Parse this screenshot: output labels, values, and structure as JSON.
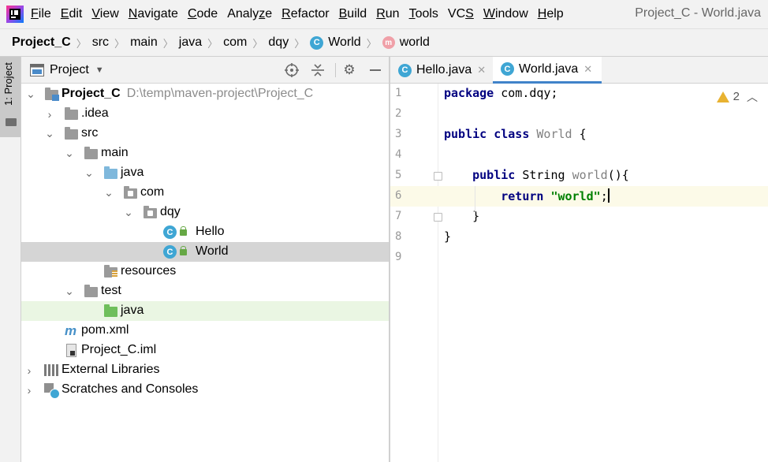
{
  "menu": {
    "items": [
      {
        "mn": "F",
        "rest": "ile"
      },
      {
        "mn": "E",
        "rest": "dit"
      },
      {
        "mn": "V",
        "rest": "iew"
      },
      {
        "mn": "N",
        "rest": "avigate"
      },
      {
        "mn": "C",
        "rest": "ode"
      },
      {
        "pre": "Analy",
        "mn": "z",
        "rest": "e"
      },
      {
        "mn": "R",
        "rest": "efactor"
      },
      {
        "mn": "B",
        "rest": "uild"
      },
      {
        "mn": "R",
        "rest": "un"
      },
      {
        "mn": "T",
        "rest": "ools"
      },
      {
        "pre": "VC",
        "mn": "S",
        "rest": ""
      },
      {
        "mn": "W",
        "rest": "indow"
      },
      {
        "mn": "H",
        "rest": "elp"
      }
    ],
    "window_title": "Project_C - World.java"
  },
  "breadcrumb": {
    "items": [
      "Project_C",
      "src",
      "main",
      "java",
      "com",
      "dqy",
      "World",
      "world"
    ]
  },
  "left_strip": {
    "label": "1: Project"
  },
  "project_panel": {
    "title": "Project",
    "dropdown_icon": "chevron-down-icon",
    "tools": [
      "locate-icon",
      "collapse-all-icon",
      "gear-icon",
      "minimize-icon"
    ],
    "root_name": "Project_C",
    "root_path": "D:\\temp\\maven-project\\Project_C",
    "nodes": {
      "idea": ".idea",
      "src": "src",
      "main": "main",
      "main_java": "java",
      "com": "com",
      "dqy": "dqy",
      "hello": "Hello",
      "world": "World",
      "resources": "resources",
      "test": "test",
      "test_java": "java",
      "pom": "pom.xml",
      "iml": "Project_C.iml",
      "libraries": "External Libraries",
      "scratches": "Scratches and Consoles"
    },
    "selected": "World"
  },
  "editor": {
    "tabs": [
      {
        "label": "Hello.java",
        "active": false
      },
      {
        "label": "World.java",
        "active": true
      }
    ],
    "warnings_count": "2",
    "line_numbers": [
      "1",
      "2",
      "3",
      "4",
      "5",
      "6",
      "7",
      "8",
      "9"
    ],
    "code": {
      "l1_kw": "package",
      "l1_rest": " com.dqy;",
      "l3_kw1": "public",
      "l3_kw2": "class",
      "l3_name": "World",
      "l3_rest": " {",
      "l5_kw": "public",
      "l5_type": " String ",
      "l5_name": "world",
      "l5_rest": "(){",
      "l6_kw": "return",
      "l6_str": "\"world\"",
      "l6_rest": ";",
      "l7": "}",
      "l8": "}"
    },
    "current_line": 6
  },
  "colors": {
    "accent": "#4083c9",
    "keyword": "#000080",
    "string": "#008000",
    "selection": "#d5d5d5",
    "current_line": "#fcfae8"
  }
}
